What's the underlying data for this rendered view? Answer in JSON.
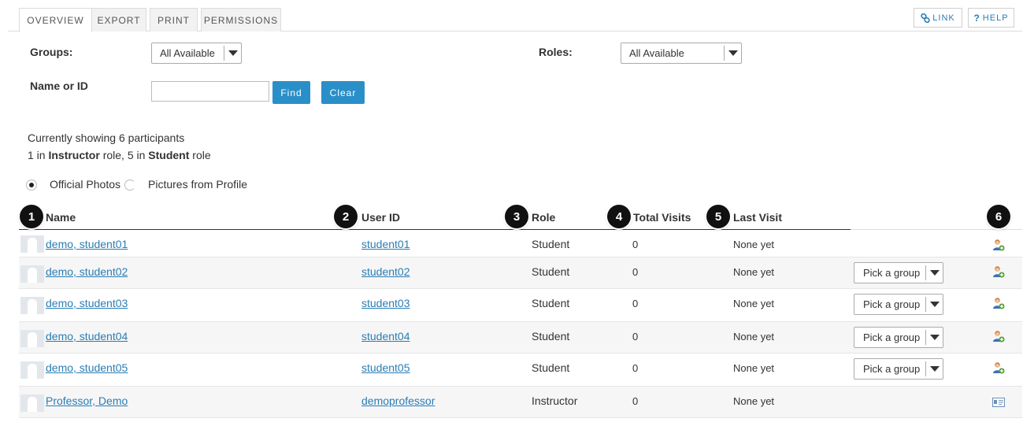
{
  "tabs": [
    {
      "label": "OVERVIEW",
      "active": true
    },
    {
      "label": "EXPORT",
      "active": false
    },
    {
      "label": "PRINT",
      "active": false
    },
    {
      "label": "PERMISSIONS",
      "active": false
    }
  ],
  "toolbar": {
    "link_label": "LINK",
    "help_label": "HELP"
  },
  "filters": {
    "groups_label": "Groups:",
    "groups_value": "All Available",
    "roles_label": "Roles:",
    "roles_value": "All Available",
    "name_label": "Name or ID",
    "name_value": "",
    "find_label": "Find",
    "clear_label": "Clear"
  },
  "summary": {
    "line1": "Currently showing 6 participants",
    "count_instructor": "1 in ",
    "instructor_role": "Instructor",
    "mid": " role, 5 in ",
    "student_role": "Student",
    "tail": " role"
  },
  "photo_options": {
    "official": "Official Photos",
    "profile": "Pictures from Profile",
    "selected": "official"
  },
  "columns": {
    "name": "Name",
    "user_id": "User ID",
    "role": "Role",
    "total_visits": "Total Visits",
    "last_visit": "Last Visit"
  },
  "badges": [
    "1",
    "2",
    "3",
    "4",
    "5",
    "6"
  ],
  "participants": [
    {
      "name": "demo, student01",
      "user_id": "student01",
      "role": "Student",
      "visits": "0",
      "last_visit": "None yet",
      "group": null
    },
    {
      "name": "demo, student02",
      "user_id": "student02",
      "role": "Student",
      "visits": "0",
      "last_visit": "None yet",
      "group": "Pick a group"
    },
    {
      "name": "demo, student03",
      "user_id": "student03",
      "role": "Student",
      "visits": "0",
      "last_visit": "None yet",
      "group": "Pick a group"
    },
    {
      "name": "demo, student04",
      "user_id": "student04",
      "role": "Student",
      "visits": "0",
      "last_visit": "None yet",
      "group": "Pick a group"
    },
    {
      "name": "demo, student05",
      "user_id": "student05",
      "role": "Student",
      "visits": "0",
      "last_visit": "None yet",
      "group": "Pick a group"
    },
    {
      "name": "Professor, Demo",
      "user_id": "demoprofessor",
      "role": "Instructor",
      "visits": "0",
      "last_visit": "None yet",
      "group": null
    }
  ],
  "colors": {
    "accent": "#2a8fc8",
    "link": "#2a7db4",
    "badge": "#111111"
  }
}
